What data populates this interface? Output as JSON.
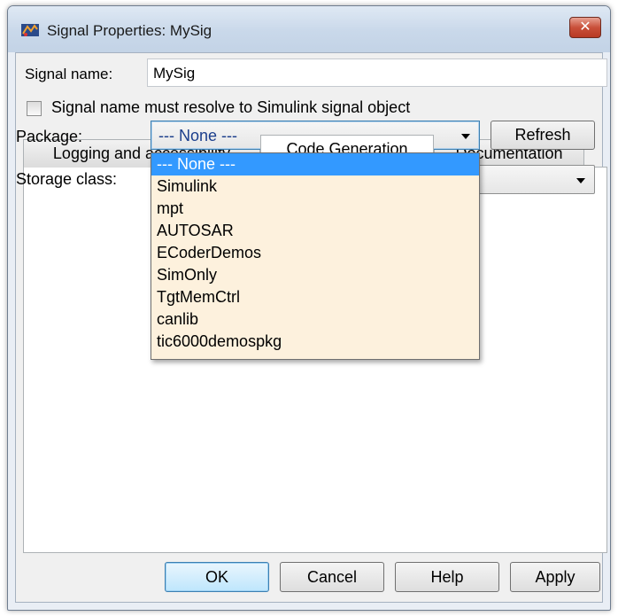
{
  "window": {
    "title": "Signal Properties: MySig",
    "close_symbol": "✕",
    "app_icon": "simulink-icon"
  },
  "signal": {
    "name_label": "Signal name:",
    "name_value": "MySig",
    "resolve_checkbox_label": "Signal name must resolve to Simulink signal object",
    "resolve_checked": false
  },
  "tabs": [
    {
      "label": "Logging and accessibility",
      "active": false
    },
    {
      "label": "Code Generation",
      "active": true
    },
    {
      "label": "Documentation",
      "active": false
    }
  ],
  "code_generation": {
    "package_label": "Package:",
    "package_value": "--- None ---",
    "refresh_label": "Refresh",
    "storage_class_label": "Storage class:",
    "storage_class_value": "",
    "package_options": [
      "--- None ---",
      "Simulink",
      "mpt",
      "AUTOSAR",
      "ECoderDemos",
      "SimOnly",
      "TgtMemCtrl",
      "canlib",
      "tic6000demospkg"
    ],
    "highlighted_option_index": 0
  },
  "buttons": {
    "ok": "OK",
    "cancel": "Cancel",
    "help": "Help",
    "apply": "Apply"
  },
  "colors": {
    "selection": "#3399ff",
    "dropdown_background": "#fdf1dd",
    "close_button": "#c9503a"
  }
}
